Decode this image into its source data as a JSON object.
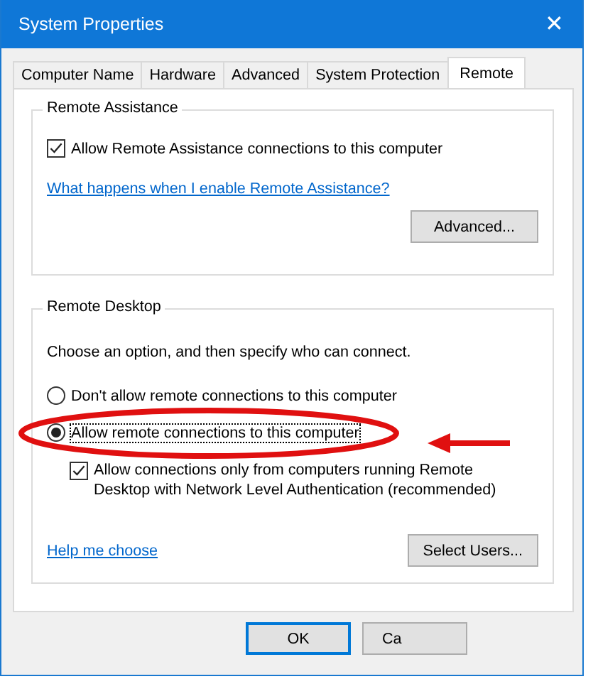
{
  "window": {
    "title": "System Properties",
    "close": "✕"
  },
  "tabs": [
    {
      "label": "Computer Name",
      "selected": false
    },
    {
      "label": "Hardware",
      "selected": false
    },
    {
      "label": "Advanced",
      "selected": false
    },
    {
      "label": "System Protection",
      "selected": false
    },
    {
      "label": "Remote",
      "selected": true
    }
  ],
  "remote_assistance": {
    "title": "Remote Assistance",
    "checkbox": {
      "label": "Allow Remote Assistance connections to this computer",
      "checked": true
    },
    "link": "What happens when I enable Remote Assistance?",
    "button": "Advanced..."
  },
  "remote_desktop": {
    "title": "Remote Desktop",
    "instruction": "Choose an option, and then specify who can connect.",
    "options": [
      {
        "label": "Don't allow remote connections to this computer",
        "selected": false
      },
      {
        "label": "Allow remote connections to this computer",
        "selected": true
      }
    ],
    "nla_checkbox": {
      "label": "Allow connections only from computers running Remote Desktop with Network Level Authentication (recommended)",
      "checked": true
    },
    "link": "Help me choose",
    "button": "Select Users..."
  },
  "buttons": [
    {
      "label": "OK",
      "default": true
    },
    {
      "label": "Ca",
      "default": false
    }
  ],
  "annotation": {
    "highlight": true,
    "arrow": true
  }
}
